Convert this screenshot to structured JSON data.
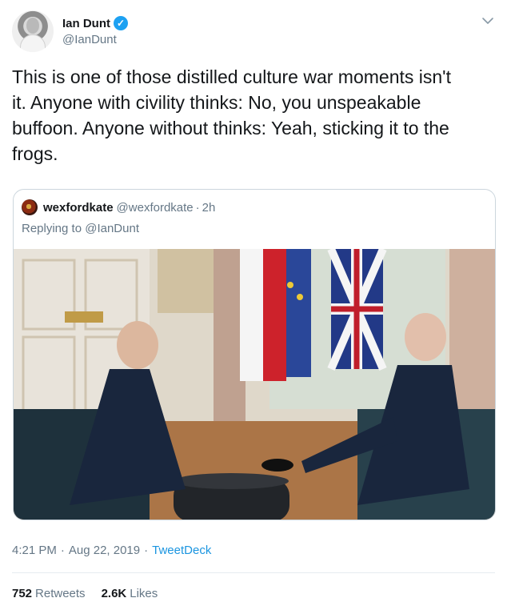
{
  "author": {
    "display_name": "Ian Dunt",
    "handle": "@IanDunt"
  },
  "tweet": {
    "text": "This is one of those distilled culture war moments isn't\nit. Anyone with civility thinks: No, you unspeakable\nbuffoon. Anyone without thinks: Yeah, sticking it to the\nfrogs."
  },
  "quote": {
    "display_name": "wexfordkate",
    "handle": "@wexfordkate",
    "separator": "·",
    "time": "2h",
    "replying_to": "Replying to",
    "mention": "@IanDunt"
  },
  "meta": {
    "time": "4:21 PM",
    "sep1": "·",
    "date": "Aug 22, 2019",
    "sep2": "·",
    "source": "TweetDeck"
  },
  "stats": {
    "retweets_count": "752",
    "retweets_label": "Retweets",
    "likes_count": "2.6K",
    "likes_label": "Likes"
  },
  "colors": {
    "accent": "#1da1f2",
    "link": "#1b95e0",
    "muted": "#657786",
    "border": "#ccd6dd"
  }
}
